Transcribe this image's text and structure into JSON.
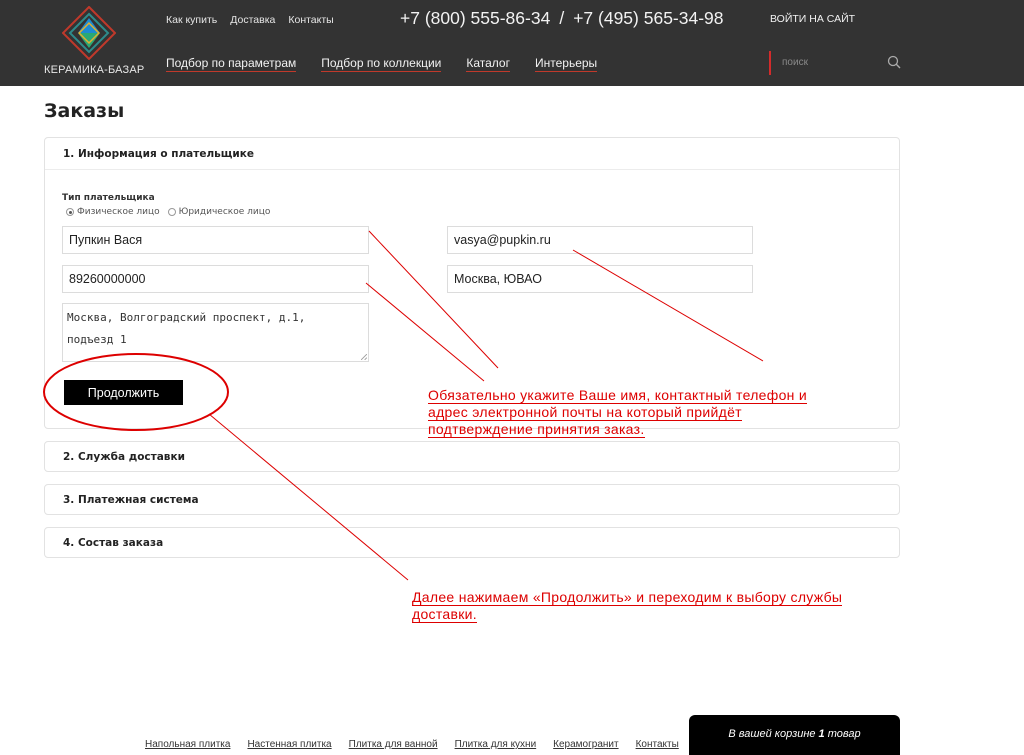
{
  "brand": {
    "logo_text": "КЕРАМИКА-БАЗАР"
  },
  "header": {
    "top_links": [
      "Как купить",
      "Доставка",
      "Контакты"
    ],
    "phone1": "+7 (800) 555-86-34",
    "phone_separator": "/",
    "phone2": "+7 (495) 565-34-98",
    "login": "ВОЙТИ НА САЙТ",
    "main_nav": [
      "Подбор по параметрам",
      "Подбор по коллекции",
      "Каталог",
      "Интерьеры"
    ],
    "search_placeholder": "поиск"
  },
  "page_title": "Заказы",
  "sections": {
    "payer": "1. Информация о плательщике",
    "delivery": "2. Служба доставки",
    "payment": "3. Платежная система",
    "order": "4. Состав заказа"
  },
  "form": {
    "payer_type_label": "Тип плательщика",
    "payer_type_options": [
      "Физическое лицо",
      "Юридическое лицо"
    ],
    "payer_type_selected": "Физическое лицо",
    "name": "Пупкин Вася",
    "email": "vasya@pupkin.ru",
    "phone": "89260000000",
    "city": "Москва, ЮВАО",
    "address": "Москва, Волгоградский проспект, д.1,\nподъезд 1",
    "continue_label": "Продолжить"
  },
  "annotations": {
    "note1_lines": [
      "Обязательно укажите Ваше имя, контактный телефон и",
      "адрес электронной почты на который прийдёт",
      "подтверждение принятия заказ."
    ],
    "note2_lines": [
      "Далее нажимаем «Продолжить» и переходим к выбору службы",
      "доставки."
    ],
    "color": "#dd0000"
  },
  "cart": {
    "prefix": "В вашей корзине",
    "count": "1",
    "suffix": "товар"
  },
  "footer": {
    "links": [
      "Напольная плитка",
      "Настенная плитка",
      "Плитка для ванной",
      "Плитка для кухни",
      "Керамогранит",
      "Контакты"
    ]
  },
  "colors": {
    "header_bg": "#333333",
    "accent": "#d32b2b",
    "button": "#000000"
  }
}
